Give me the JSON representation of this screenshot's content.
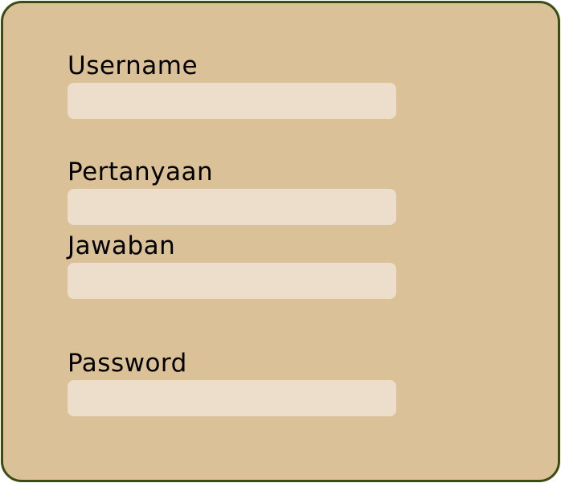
{
  "form": {
    "colors": {
      "card_background": "#dbc198",
      "card_border": "#3a4d12",
      "input_background": "#ecdeca",
      "label_text": "#000000"
    },
    "fields": {
      "username": {
        "label": "Username",
        "value": ""
      },
      "question": {
        "label": "Pertanyaan",
        "value": ""
      },
      "answer": {
        "label": "Jawaban",
        "value": ""
      },
      "password": {
        "label": "Password",
        "value": ""
      }
    }
  }
}
